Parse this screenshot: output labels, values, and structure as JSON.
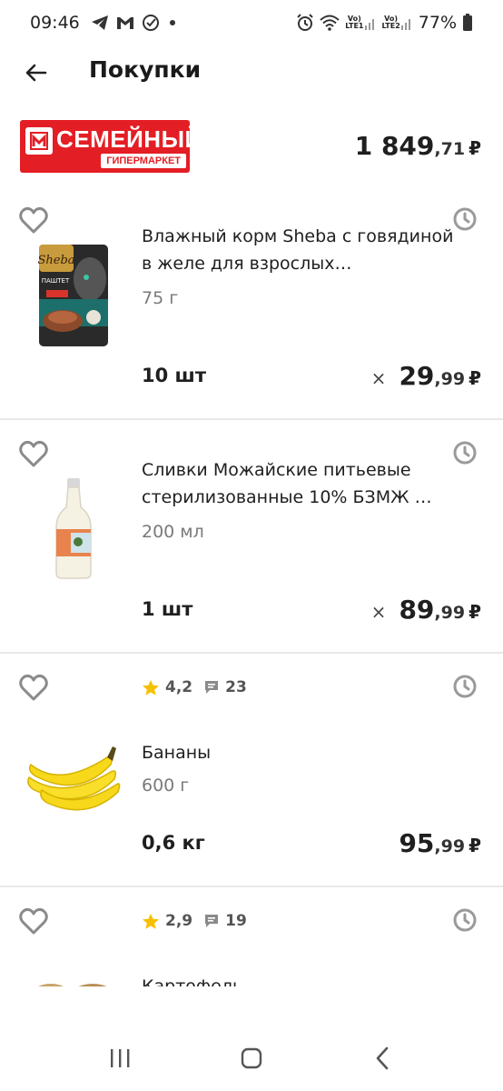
{
  "status_bar": {
    "time": "09:46",
    "notification_icons": [
      "telegram-icon",
      "gmail-icon",
      "check-circle-icon",
      "dot-icon"
    ],
    "sim1_label_top": "Vo)",
    "sim1_label_bottom": "LTE1",
    "sim2_label_top": "Vo)",
    "sim2_label_bottom": "LTE2",
    "battery": "77%"
  },
  "header": {
    "title": "Покупки"
  },
  "store": {
    "logo_name": "СЕМЕЙНЫЙ",
    "logo_subtitle": "ГИПЕРМАРКЕТ",
    "brand_color": "#e31e24",
    "total_int": "1 849",
    "total_frac": ",71",
    "currency": "₽"
  },
  "products": [
    {
      "name": "Влажный корм Sheba с говядиной в желе для взрослых…",
      "weight": "75 г",
      "qty": "10 шт",
      "multiplier": "×",
      "price_int": "29",
      "price_frac": ",99",
      "currency": "₽",
      "image": "sheba-cat-food-pouch",
      "pack_brand": "Sheba",
      "pack_label": "ПАШТЕТ"
    },
    {
      "name": "Сливки Можайские питьевые стерилизованные 10% БЗМЖ …",
      "weight": "200 мл",
      "qty": "1 шт",
      "multiplier": "×",
      "price_int": "89",
      "price_frac": ",99",
      "currency": "₽",
      "image": "cream-glass-bottle"
    },
    {
      "rating": "4,2",
      "comments": "23",
      "name": "Бананы",
      "weight": "600 г",
      "qty": "0,6 кг",
      "price_int": "95",
      "price_frac": ",99",
      "currency": "₽",
      "image": "bananas"
    },
    {
      "rating": "2,9",
      "comments": "19",
      "name": "Картофель",
      "image": "potatoes"
    }
  ],
  "nav_bar": {
    "buttons": [
      "recent-apps-icon",
      "home-icon",
      "back-icon"
    ]
  }
}
